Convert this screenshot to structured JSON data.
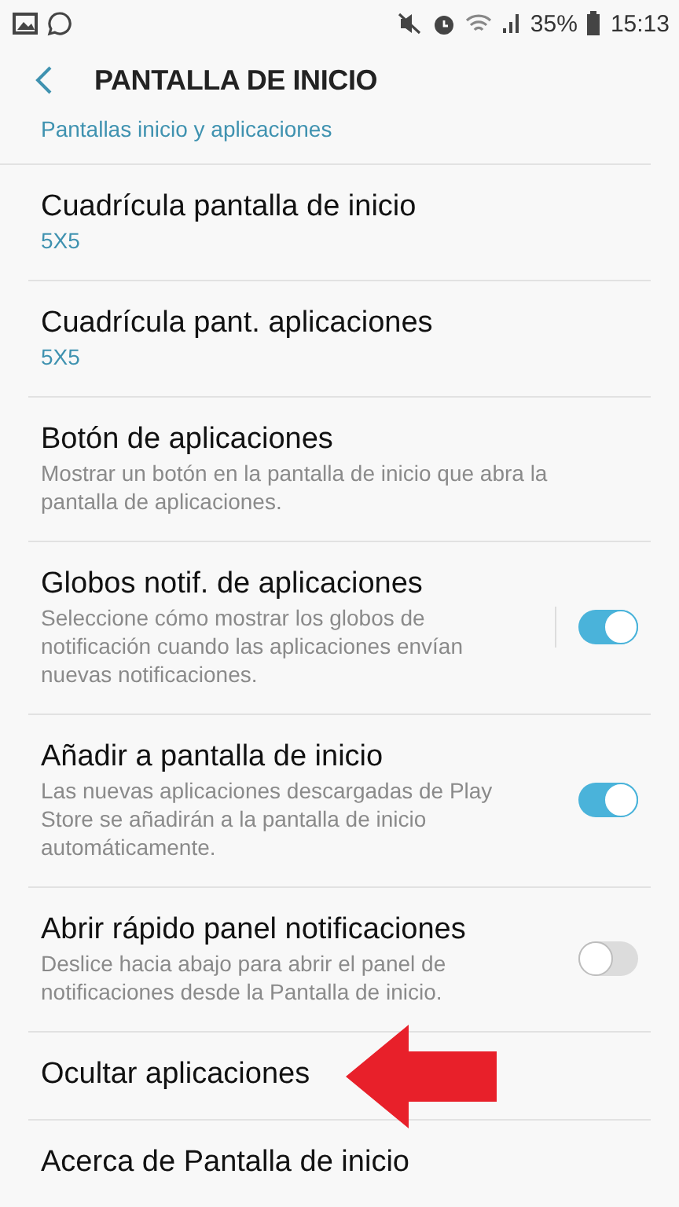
{
  "status_bar": {
    "battery": "35%",
    "time": "15:13"
  },
  "header": {
    "title": "PANTALLA DE INICIO"
  },
  "partial_item": {
    "subtitle": "Pantallas inicio y aplicaciones"
  },
  "items": [
    {
      "kind": "value",
      "title": "Cuadrícula pantalla de inicio",
      "value": "5X5"
    },
    {
      "kind": "value",
      "title": "Cuadrícula pant. aplicaciones",
      "value": "5X5"
    },
    {
      "kind": "summary",
      "title": "Botón de aplicaciones",
      "summary": "Mostrar un botón en la pantalla de inicio que abra la pantalla de aplicaciones."
    },
    {
      "kind": "switch",
      "title": "Globos notif. de aplicaciones",
      "summary": "Seleccione cómo mostrar los globos de notificación cuando las aplicaciones envían nuevas notificaciones.",
      "on": true,
      "split": true
    },
    {
      "kind": "switch",
      "title": "Añadir a pantalla de inicio",
      "summary": "Las nuevas aplicaciones descargadas de Play Store se añadirán a la pantalla de inicio automáticamente.",
      "on": true,
      "split": false
    },
    {
      "kind": "switch",
      "title": "Abrir rápido panel notificaciones",
      "summary": "Deslice hacia abajo para abrir el panel de notificaciones desde la Pantalla de inicio.",
      "on": false,
      "split": false
    },
    {
      "kind": "plain",
      "title": "Ocultar aplicaciones"
    },
    {
      "kind": "plain",
      "title": "Acerca de Pantalla de inicio"
    }
  ]
}
